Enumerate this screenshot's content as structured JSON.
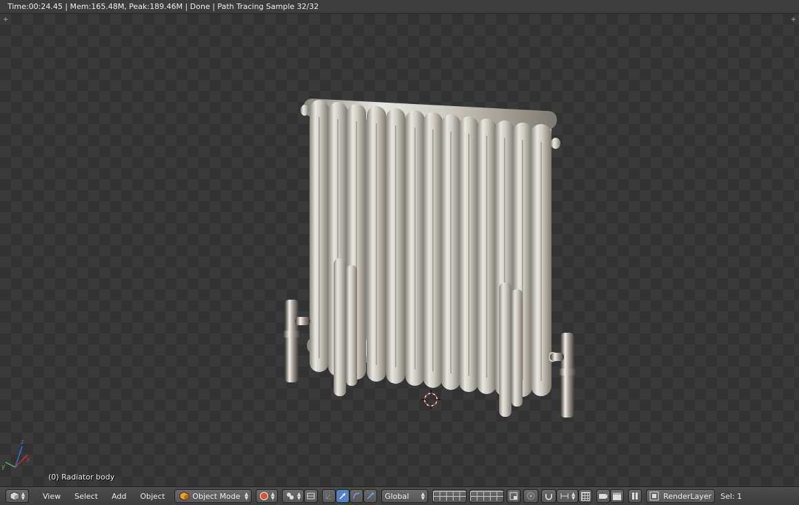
{
  "statusbar": {
    "text": "Time:00:24.45 | Mem:165.48M, Peak:189.46M | Done | Path Tracing Sample 32/32"
  },
  "viewport": {
    "object_label": "(0) Radiator body"
  },
  "toolbar": {
    "menus": {
      "view": "View",
      "select": "Select",
      "add": "Add",
      "object": "Object"
    },
    "mode": "Object Mode",
    "transform_orientation": "Global",
    "render_layer": "RenderLayer",
    "selection": "Sel: 1"
  },
  "colors": {
    "accent_blue": "#5680c2",
    "header_bg": "#3d3d3d"
  },
  "icons": [
    "editor-type-icon",
    "object-mode-cube-icon",
    "viewport-shading-icon",
    "pivot-point-icon",
    "manipulator-icon",
    "translate-icon",
    "rotate-icon",
    "scale-icon",
    "layer-grid-icon",
    "snap-icon",
    "proportional-edit-icon",
    "render-camera-icon",
    "clapper-icon",
    "pause-icon",
    "render-layers-icon"
  ]
}
